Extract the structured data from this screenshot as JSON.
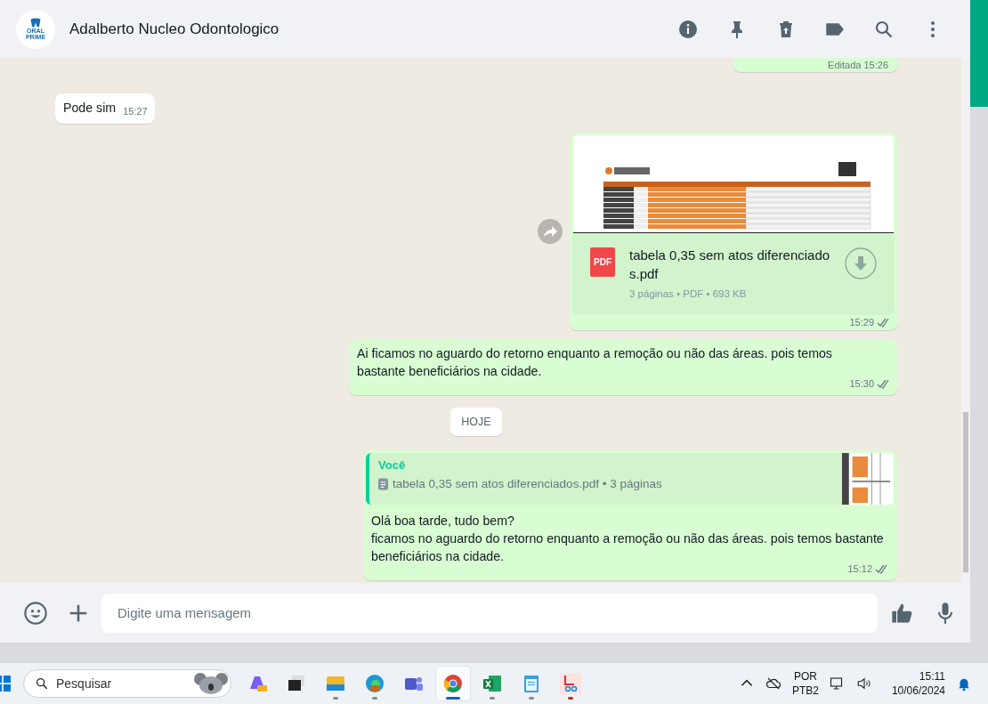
{
  "header": {
    "avatar_text": "ORAL PRIME",
    "contact": "Adalberto Nucleo Odontologico"
  },
  "messages": [
    {
      "kind": "edited",
      "outgoing": true,
      "label": "Editada",
      "time": "15:26"
    },
    {
      "kind": "text",
      "outgoing": false,
      "lines": [
        "Pode sim"
      ],
      "time": "15:27"
    },
    {
      "kind": "document",
      "outgoing": true,
      "file_name": "tabela 0,35 sem atos diferenciados.pdf",
      "file_type": "PDF",
      "meta": "3 páginas • PDF • 693 KB",
      "time": "15:29"
    },
    {
      "kind": "text",
      "outgoing": true,
      "lines": [
        "Ai ficamos no aguardo do retorno enquanto a remoção ou não das áreas. pois temos bastante beneficiários na cidade."
      ],
      "time": "15:30"
    },
    {
      "kind": "date",
      "label": "HOJE"
    },
    {
      "kind": "reply",
      "outgoing": true,
      "quote_author": "Você",
      "quote_text": "tabela 0,35 sem atos diferenciados.pdf • 3 páginas",
      "lines": [
        "Olá boa tarde, tudo bem?",
        "ficamos no aguardo do retorno enquanto a remoção ou não das áreas. pois temos bastante beneficiários na cidade."
      ],
      "time": "15:12"
    }
  ],
  "composer": {
    "placeholder": "Digite uma mensagem"
  },
  "taskbar": {
    "search_placeholder": "Pesquisar",
    "apps": [
      {
        "kind": "copilot",
        "running": false,
        "selected": false
      },
      {
        "kind": "taskview",
        "running": false,
        "selected": false
      },
      {
        "kind": "explorer",
        "running": true,
        "selected": false
      },
      {
        "kind": "edge",
        "running": true,
        "selected": false
      },
      {
        "kind": "teams",
        "running": false,
        "selected": false
      },
      {
        "kind": "chrome",
        "running": true,
        "selected": true
      },
      {
        "kind": "excel",
        "running": true,
        "selected": false
      },
      {
        "kind": "notepad",
        "running": true,
        "selected": false
      },
      {
        "kind": "snip",
        "running": true,
        "selected": false
      }
    ],
    "lang_top": "POR",
    "lang_bottom": "PTB2",
    "time": "15:11",
    "date": "10/06/2024"
  }
}
